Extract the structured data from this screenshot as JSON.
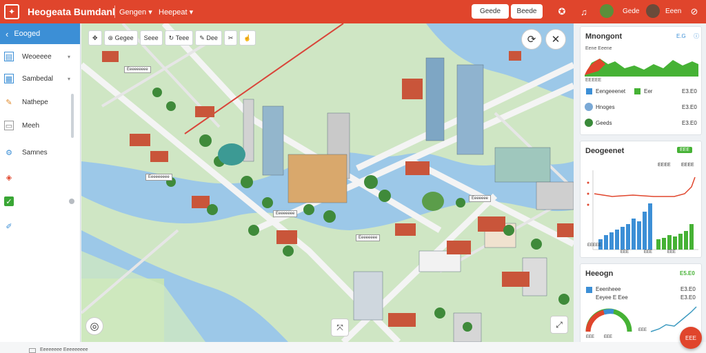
{
  "header": {
    "title": "Heogeata Bumdanl",
    "menu": [
      "Gengen ▾",
      "Heepeat ▾"
    ],
    "buttons": [
      "Geede",
      "Beede"
    ],
    "text": [
      "Gede",
      "Eeen"
    ],
    "colors": {
      "brand": "#e0452c",
      "accent": "#3c8fd6"
    }
  },
  "sidebar": {
    "header": "Eooged",
    "items": [
      {
        "label": "Weoeeee",
        "icon": "book-icon",
        "arrow": "▾"
      },
      {
        "label": "Sambedal",
        "icon": "shield-icon",
        "arrow": "▾"
      },
      {
        "label": "Nathepe",
        "icon": "pencil-icon",
        "arrow": ""
      },
      {
        "label": "Meeh",
        "icon": "document-icon",
        "arrow": ""
      },
      {
        "label": "Samnes",
        "icon": "wrench-icon",
        "arrow": ""
      },
      {
        "label": "",
        "icon": "tag-icon",
        "arrow": ""
      },
      {
        "label": "",
        "icon": "check-icon",
        "arrow": ""
      },
      {
        "label": "",
        "icon": "ruler-icon",
        "arrow": ""
      }
    ]
  },
  "map": {
    "tools": [
      "Gegee",
      "Seee",
      "Teee",
      "Dee"
    ],
    "labels": [
      "Eeeeeeeee",
      "Eeeeeeeee",
      "Eeeeeeee",
      "Eeeeeeee",
      "Eeeeeee"
    ]
  },
  "panels": {
    "top": {
      "title": "Mnongont",
      "badge": "E.G",
      "sub": "Eene Eeene",
      "value_label": "EEEEE",
      "rows": [
        {
          "label": "Eengeeenet",
          "extra": "Eer",
          "value": "E3.E0"
        },
        {
          "label": "Hnoges",
          "extra": "",
          "value": "E3.E0"
        },
        {
          "label": "Geeds",
          "extra": "",
          "value": "E3.E0"
        }
      ]
    },
    "middle": {
      "title": "Deogeenet",
      "badge": "EEE",
      "sub1": "EEEE",
      "sub2": "EEEE",
      "axis": [
        "EEEEE",
        "EEE",
        "EEE",
        "EEE"
      ]
    },
    "bottom": {
      "title": "Heeogn",
      "value": "E5.E0",
      "rows": [
        {
          "label": "Eeenheee",
          "value": "E3.E0"
        },
        {
          "label": "Eeyee E Eee",
          "value": "E3.E0"
        }
      ],
      "gauge_values": [
        "EEE",
        "EEE",
        "EEE"
      ]
    }
  },
  "bottom_bar": {
    "text": "Eeeeeeee Eeeeeeeee",
    "fab_label": "EEE"
  }
}
